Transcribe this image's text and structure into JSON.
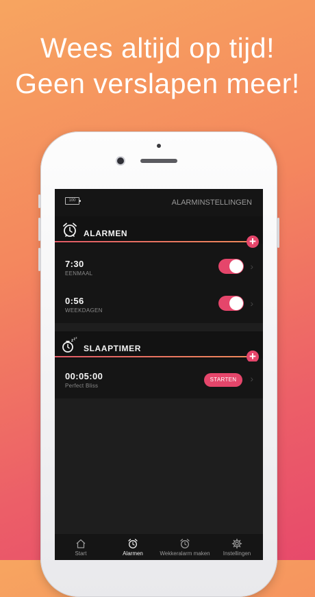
{
  "headline": {
    "line1": "Wees altijd op tijd!",
    "line2": "Geen verslapen meer!"
  },
  "status": {
    "battery": "100"
  },
  "nav": {
    "title": "ALARMINSTELLINGEN"
  },
  "alarms_section": {
    "title": "ALARMEN",
    "icon": "alarm-clock-icon",
    "add": "+",
    "items": [
      {
        "time": "7:30",
        "repeat": "EENMAAL",
        "enabled": true
      },
      {
        "time": "0:56",
        "repeat": "WEEKDAGEN",
        "enabled": true
      }
    ]
  },
  "sleeptimer_section": {
    "title": "SLAAPTIMER",
    "icon": "stopwatch-zzz-icon",
    "add": "+",
    "timer": {
      "time": "00:05:00",
      "sound": "Perfect Bliss",
      "start_label": "STARTEN"
    }
  },
  "tabs": [
    {
      "label": "Start",
      "icon": "home-icon",
      "active": false
    },
    {
      "label": "Alarmen",
      "icon": "alarm-clock-icon",
      "active": true
    },
    {
      "label": "Wekkeralarm maken",
      "icon": "alarm-settings-icon",
      "active": false
    },
    {
      "label": "Instellingen",
      "icon": "gear-icon",
      "active": false
    }
  ],
  "colors": {
    "accent": "#e5466b",
    "background_from": "#f7a560",
    "background_to": "#e74a6b"
  }
}
